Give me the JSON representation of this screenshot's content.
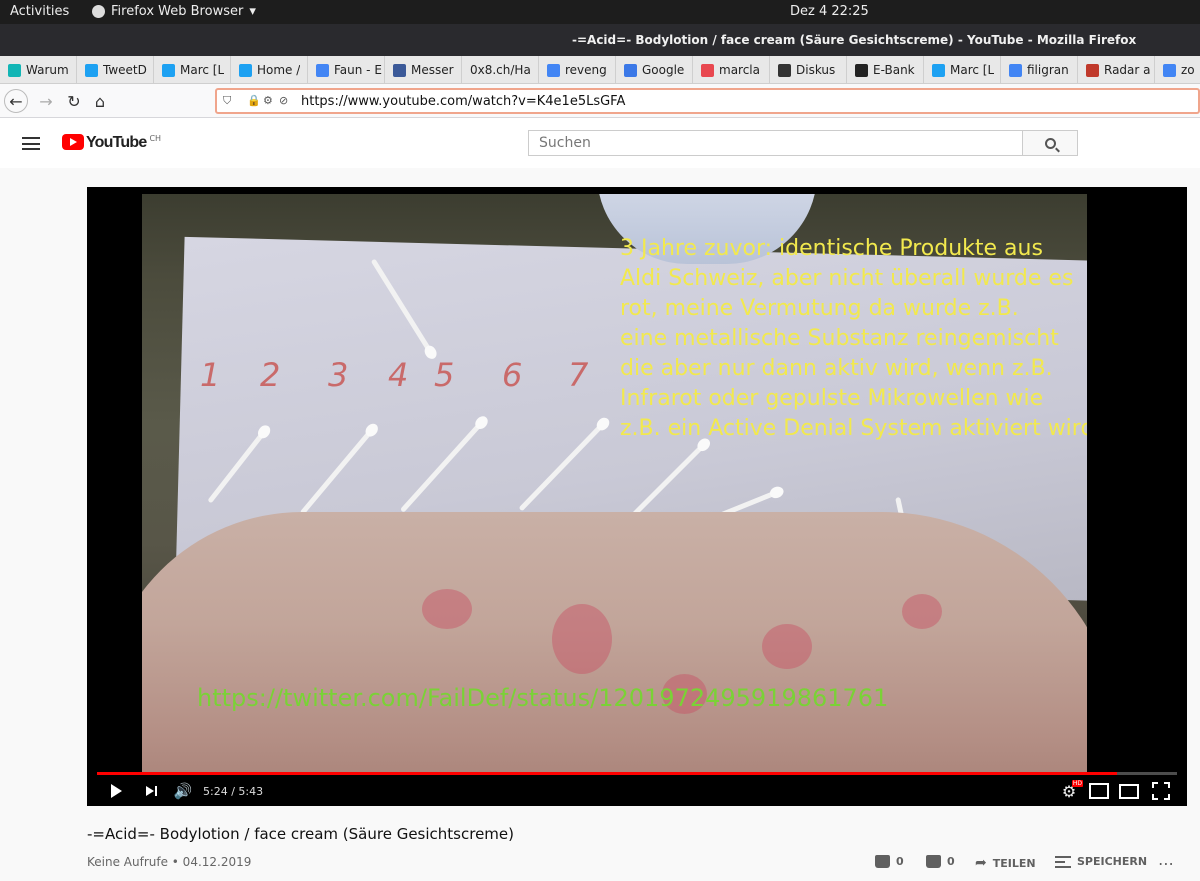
{
  "system": {
    "activities": "Activities",
    "app_name": "Firefox Web Browser",
    "clock": "Dez 4  22:25"
  },
  "window": {
    "title": "-=Acid=- Bodylotion / face cream (Säure Gesichtscreme) - YouTube - Mozilla Firefox"
  },
  "tabs": [
    {
      "label": "Warum",
      "icon": "heart-icon",
      "color": "#12b5b5"
    },
    {
      "label": "TweetD",
      "icon": "twitter-icon",
      "color": "#1da1f2"
    },
    {
      "label": "Marc [L",
      "icon": "twitter-icon",
      "color": "#1da1f2"
    },
    {
      "label": "Home /",
      "icon": "twitter-icon",
      "color": "#1da1f2"
    },
    {
      "label": "Faun - E",
      "icon": "google-icon",
      "color": "#4285f4"
    },
    {
      "label": "Messer",
      "icon": "facebook-icon",
      "color": "#3b5998"
    },
    {
      "label": "0x8.ch/Ha",
      "icon": "",
      "color": ""
    },
    {
      "label": "reveng",
      "icon": "google-icon",
      "color": "#4285f4"
    },
    {
      "label": "Google",
      "icon": "translate-icon",
      "color": "#3b78e7"
    },
    {
      "label": "marcla",
      "icon": "page-icon",
      "color": "#e8474f"
    },
    {
      "label": "Diskus",
      "icon": "wikipedia-icon",
      "color": "#333333"
    },
    {
      "label": "E-Bank",
      "icon": "bank-icon",
      "color": "#222222"
    },
    {
      "label": "Marc [L",
      "icon": "twitter-icon",
      "color": "#1da1f2"
    },
    {
      "label": "filigran",
      "icon": "google-icon",
      "color": "#4285f4"
    },
    {
      "label": "Radar a",
      "icon": "s-icon",
      "color": "#c0392b"
    },
    {
      "label": "zo",
      "icon": "google-icon",
      "color": "#4285f4"
    }
  ],
  "navbar": {
    "url": "https://www.youtube.com/watch?v=K4e1e5LsGFA"
  },
  "youtube": {
    "logo_text": "YouTube",
    "country": "CH",
    "search_placeholder": "Suchen"
  },
  "video": {
    "numbers": [
      "1",
      "2",
      "3",
      "4",
      "5",
      "6",
      "7"
    ],
    "caption_lines": [
      "3 Jahre zuvor: identische Produkte aus",
      "Aldi Schweiz, aber nicht überall wurde es",
      "rot, meine Vermutung da wurde z.B.",
      "eine metallische Substanz reingemischt",
      "die aber nur dann aktiv wird, wenn z.B.",
      "Infrarot oder gepulste Mikrowellen wie",
      "z.B. ein Active Denial System aktiviert wird"
    ],
    "overlay_url": "https://twitter.com/FailDef/status/1201972495919861761",
    "time_display": "5:24 / 5:43",
    "progress_fraction": 0.944,
    "hd_badge": "HD"
  },
  "info": {
    "title": "-=Acid=- Bodylotion / face cream (Säure Gesichtscreme)",
    "meta": "Keine Aufrufe • 04.12.2019",
    "likes": "0",
    "dislikes": "0",
    "share_label": "TEILEN",
    "save_label": "SPEICHERN"
  },
  "colors": {
    "accent": "#ff0000",
    "caption": "#f2e94e",
    "overlay_url": "#7ad236"
  }
}
